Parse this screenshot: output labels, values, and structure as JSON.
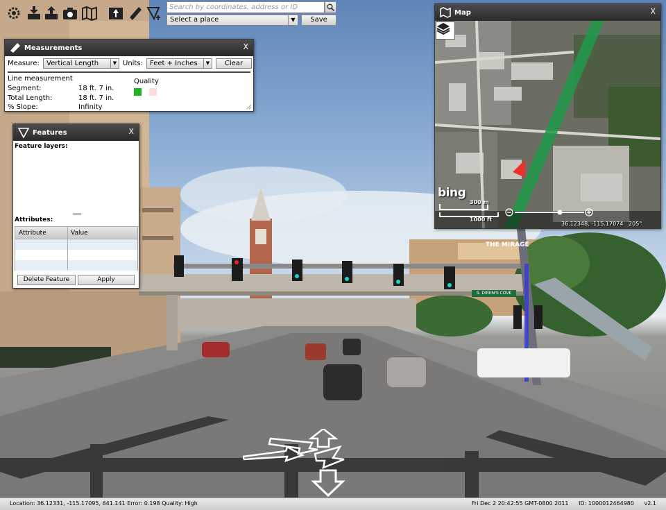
{
  "toolbar": {
    "icons": [
      "settings-icon",
      "import-icon",
      "export-icon",
      "camera-icon",
      "map-icon",
      "navigate-icon",
      "measure-ruler-icon",
      "feature-funnel-icon"
    ],
    "search_placeholder": "Search by coordinates, address or ID",
    "place_select_value": "Select a place",
    "save_label": "Save"
  },
  "measurements": {
    "title": "Measurements",
    "close": "X",
    "measure_label": "Measure:",
    "measure_value": "Vertical Length",
    "units_label": "Units:",
    "units_value": "Feet + Inches",
    "clear_label": "Clear",
    "heading": "Line measurement",
    "rows": [
      {
        "label": "Segment:",
        "value": "18 ft. 7 in."
      },
      {
        "label": "Total Length:",
        "value": "18 ft. 7 in."
      },
      {
        "label": "% Slope:",
        "value": "Infinity"
      }
    ],
    "quality_label": "Quality",
    "quality_colors": [
      "#1fb31f",
      "#ffdcdc"
    ]
  },
  "features": {
    "title": "Features",
    "close": "X",
    "layers_label": "Feature layers:",
    "attributes_label": "Attributes:",
    "col_attribute": "Attribute",
    "col_value": "Value",
    "delete_label": "Delete Feature",
    "apply_label": "Apply"
  },
  "map": {
    "title": "Map",
    "close": "X",
    "bing": "bing",
    "scale_m": "300 m",
    "scale_ft": "1000 ft",
    "coords": "36.12348, -115.17074",
    "heading": "205°"
  },
  "street_signs": {
    "mirage": "THE MIRAGE",
    "street": "S. DIREN'S COVE"
  },
  "status": {
    "location": "Location: 36.12331, -115.17095, 641.141 Error: 0.198 Quality: High",
    "datetime": "Fri Dec 2 20:42:55 GMT-0800 2011",
    "id": "ID: 1000012464980",
    "version": "v2.1"
  }
}
